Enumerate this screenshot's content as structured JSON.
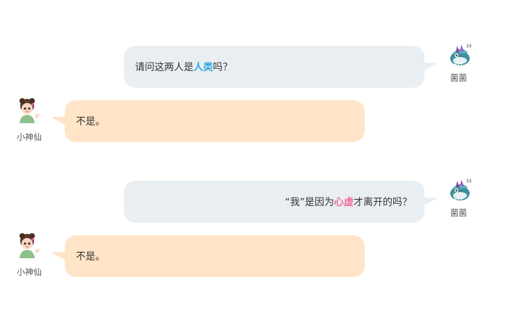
{
  "conversation": {
    "messages": [
      {
        "side": "right",
        "speaker": "菌菌",
        "text_before": "请问这两人是",
        "highlight": "人类",
        "text_after": "吗？",
        "highlight_color": "#29a9e0"
      },
      {
        "side": "left",
        "speaker": "小神仙",
        "text": "不是。"
      },
      {
        "side": "right",
        "speaker": "菌菌",
        "text_before": "“我”是因为",
        "highlight": "心虚",
        "text_after": "才离开的吗？",
        "highlight_color": "#f06c9b"
      },
      {
        "side": "left",
        "speaker": "小神仙",
        "text": "不是。"
      }
    ]
  },
  "colors": {
    "user_bubble": "#e9eef2",
    "npc_bubble": "#ffe4c7",
    "text": "#333333"
  },
  "icons": {
    "user_avatar": "shark-creature-avatar-icon",
    "npc_avatar": "girl-character-avatar-icon"
  }
}
